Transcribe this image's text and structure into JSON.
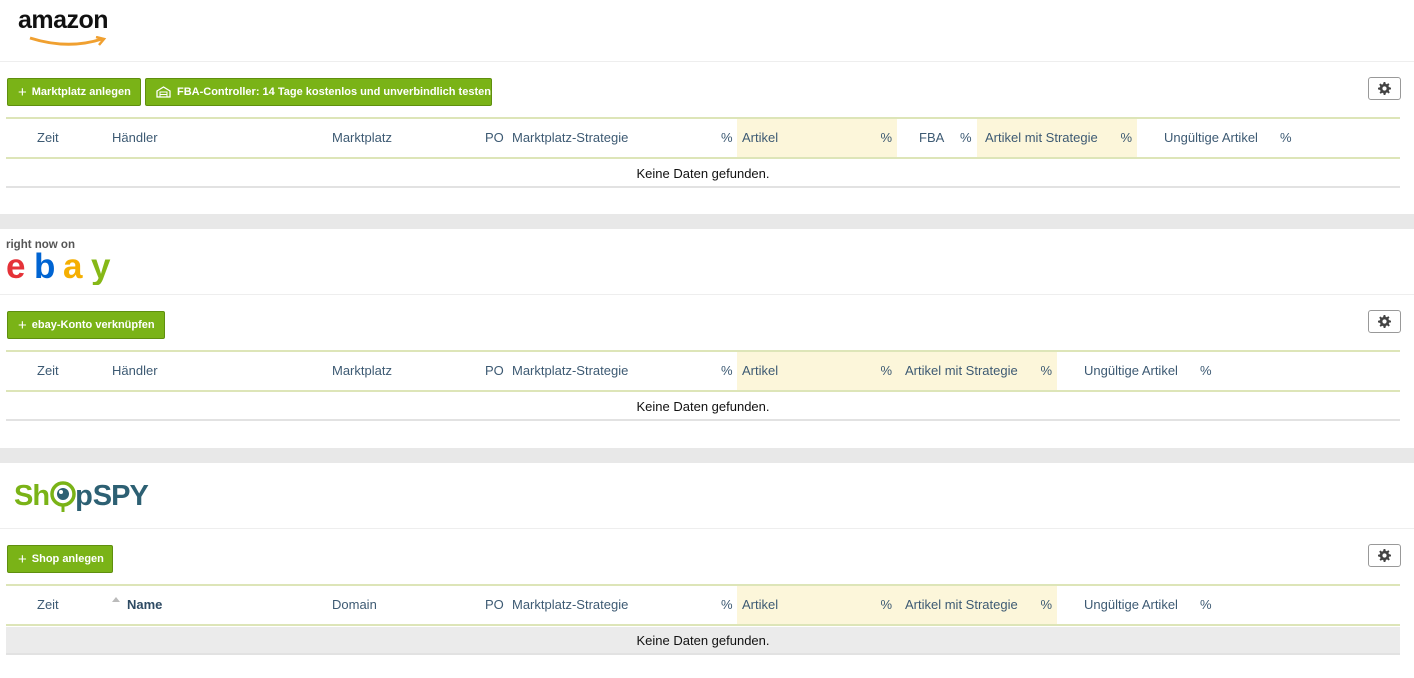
{
  "amazon": {
    "logo_text": "amazon",
    "buttons": [
      {
        "label": "Marktplatz anlegen"
      },
      {
        "label": "FBA-Controller: 14 Tage kostenlos und unverbindlich testen"
      }
    ],
    "columns": [
      "Zeit",
      "Händler",
      "Marktplatz",
      "PO",
      "Marktplatz-Strategie",
      "%",
      "Artikel",
      "%",
      "FBA",
      "%",
      "Artikel mit Strategie",
      "%",
      "Ungültige Artikel",
      "%"
    ],
    "empty_text": "Keine Daten gefunden."
  },
  "ebay": {
    "logo_tagline": "right now on",
    "logo_text": "ebay",
    "buttons": [
      {
        "label": "ebay-Konto verknüpfen"
      }
    ],
    "columns": [
      "Zeit",
      "Händler",
      "Marktplatz",
      "PO",
      "Marktplatz-Strategie",
      "%",
      "Artikel",
      "%",
      "Artikel mit Strategie",
      "%",
      "Ungültige Artikel",
      "%"
    ],
    "empty_text": "Keine Daten gefunden."
  },
  "shopspy": {
    "logo_text_part1": "Sh",
    "logo_text_part2": "p",
    "logo_text_part3": "SPY",
    "buttons": [
      {
        "label": "Shop anlegen"
      }
    ],
    "columns": [
      "Zeit",
      "Name",
      "Domain",
      "PO",
      "Marktplatz-Strategie",
      "%",
      "Artikel",
      "%",
      "Artikel mit Strategie",
      "%",
      "Ungültige Artikel",
      "%"
    ],
    "empty_text": "Keine Daten gefunden."
  },
  "icons": {
    "plus": "+",
    "gear": "gear-icon",
    "warehouse": "warehouse-icon",
    "sort": "sort-asc-icon"
  },
  "colors": {
    "button_green": "#7ab317",
    "highlight_column": "#fcf6da",
    "header_text": "#3d5a73",
    "section_gap": "#e8e8e8"
  }
}
